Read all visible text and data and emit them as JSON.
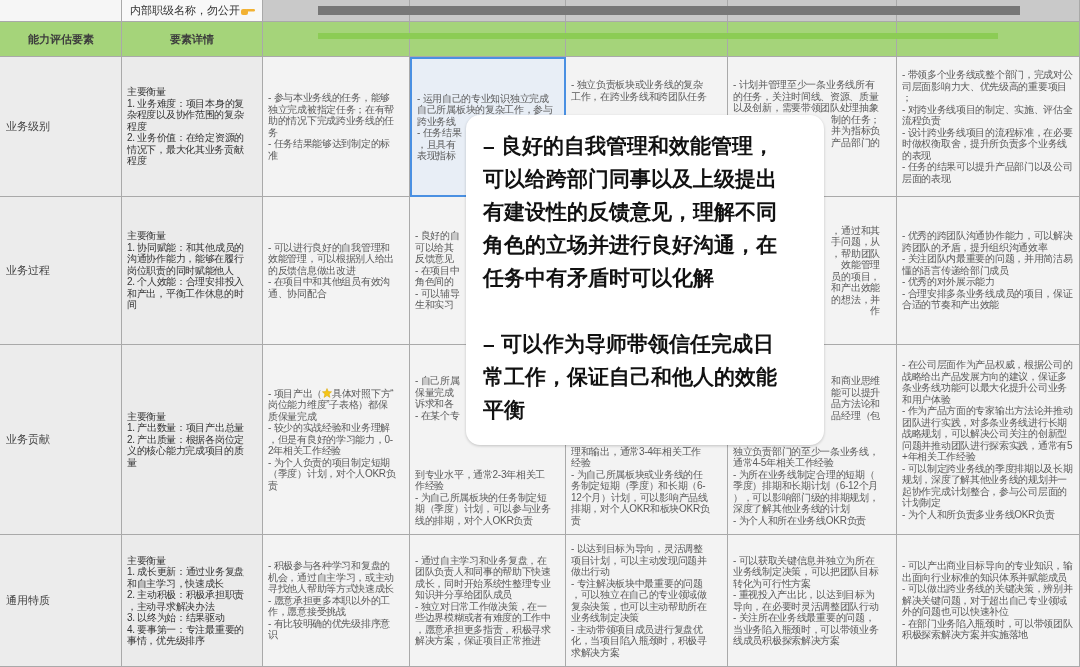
{
  "header": {
    "note": "内部职级名称，勿公开"
  },
  "columns": [
    "能力评估要素",
    "要素详情"
  ],
  "rows": [
    {
      "label": "业务级别",
      "detail": "主要衡量\n1. 业务难度：项目本身的复杂程度以及协作范围的复杂程度\n2. 业务价值：在给定资源的情况下，最大化其业务贡献程度",
      "cells": [
        {
          "kind": "text",
          "selected": false,
          "text": "- 参与本业务线的任务，能够独立完成被指定任务；在有帮助的情况下完成跨业务线的任务\n- 任务结果能够达到制定的标准"
        },
        {
          "kind": "pieces",
          "selected": true,
          "pieces": [
            {
              "text": "- 运用自己的专业知识独立完成自己所属板块的复杂工作，参与",
              "start_hidden": false
            },
            {
              "text": "跨业务线",
              "start_hidden": false
            },
            {
              "text": "- 任务结果",
              "start_hidden": false
            },
            {
              "text": "，且具有",
              "start_hidden": false
            },
            {
              "text": "表现指标",
              "start_hidden": false
            }
          ]
        },
        {
          "kind": "top",
          "selected": false,
          "pieces": [
            {
              "text": "- 独立负责板块或业务线的复杂工作，在跨业务线和跨团队任务",
              "start_hidden": false
            }
          ]
        },
        {
          "kind": "top",
          "selected": false,
          "pieces": [
            {
              "text": "- 计划并管理至少一条业务线所有的任务，关注时间线、资源、质量以及创新，需要带领团队处理抽象",
              "start_hidden": false
            },
            {
              "text": "制的任务；",
              "start_hidden": true
            },
            {
              "text": "并为指标负",
              "start_hidden": true
            },
            {
              "text": "产品部门的",
              "start_hidden": true
            }
          ]
        },
        {
          "kind": "text",
          "selected": false,
          "text": "- 带领多个业务线或整个部门，完成对公司层面影响力大、优先级高的重要项目；\n- 对跨业务线项目的制定、实施、评估全流程负责\n- 设计跨业务线项目的流程标准，在必要时做权衡取舍，提升所负责多个业务线的表现\n- 任务的结果可以提升产品部门以及公司层面的表现"
        }
      ]
    },
    {
      "label": "业务过程",
      "detail": "主要衡量\n1. 协同赋能：和其他成员的沟通协作能力，能够在履行岗位职责的同时赋能他人\n2. 个人效能：合理安排投入和产出，平衡工作休息的时间",
      "cells": [
        {
          "kind": "text",
          "selected": false,
          "text": "- 可以进行良好的自我管理和效能管理，可以根据别人给出的反馈信息做出改进\n- 在项目中和其他组员有效沟通、协同配合"
        },
        {
          "kind": "pieces",
          "selected": false,
          "pieces": [
            {
              "text": "- 良好的自",
              "start_hidden": false
            },
            {
              "text": "可以给其",
              "start_hidden": false
            },
            {
              "text": "反馈意见",
              "start_hidden": false
            },
            {
              "text": "- 在项目中",
              "start_hidden": false
            },
            {
              "text": "角色间的",
              "start_hidden": false
            },
            {
              "text": "- 可以辅导",
              "start_hidden": false
            },
            {
              "text": "生和实习",
              "start_hidden": false
            }
          ]
        },
        {
          "kind": "covered"
        },
        {
          "kind": "pieces",
          "selected": false,
          "pieces": [
            {
              "text": "，通过和其",
              "start_hidden": true
            },
            {
              "text": "手问题，从",
              "start_hidden": true
            },
            {
              "text": "，帮助团队",
              "start_hidden": true
            },
            {
              "text": "效能管理",
              "start_hidden": true
            },
            {
              "text": "员的项目，",
              "start_hidden": true
            },
            {
              "text": "和产出效能",
              "start_hidden": true
            },
            {
              "text": "的想法，并",
              "start_hidden": true
            },
            {
              "text": "作",
              "start_hidden": true
            }
          ]
        },
        {
          "kind": "text",
          "selected": false,
          "text": "- 优秀的跨团队沟通协作能力，可以解决跨团队的矛盾，提升组织沟通效率\n- 关注团队内最重要的问题，并用简洁易懂的语言传递给部门成员\n- 优秀的对外展示能力\n- 合理安排多条业务线成员的项目，保证合适的节奏和产出效能"
        }
      ]
    },
    {
      "label": "业务贡献",
      "detail": "主要衡量\n1. 产出数量：项目产出总量\n2. 产出质量：根据各岗位定义的核心能力完成项目的质量",
      "cells": [
        {
          "kind": "star_text",
          "selected": false,
          "before": "- 项目产出（",
          "text": "具体对照下方“岗位能力维度”子表格）都保质保量完成\n- 较少的实战经验和业务理解，但是有良好的学习能力，0-2年相关工作经验\n- 为个人负责的项目制定短期（季度）计划，对个人OKR负责"
        },
        {
          "kind": "split",
          "selected": false,
          "above": [
            {
              "text": "- 自己所属",
              "start_hidden": false
            },
            {
              "text": "保量完成",
              "start_hidden": false
            },
            {
              "text": "诉求和各",
              "start_hidden": false
            },
            {
              "text": "- 在某个专",
              "start_hidden": false
            }
          ],
          "below": [
            {
              "text": "到专业水平，通常2-3年相关工作经验\n- 为自己所属板块的任务制定短期（季度）计划，可以参与业务线的排期，对个人OKR负责",
              "start_hidden": false
            }
          ]
        },
        {
          "kind": "bottom",
          "selected": false,
          "pieces": [
            {
              "text": "理和输出，通常3-4年相关工作经验\n- 为自己所属板块或业务线的任务制定短期（季度）和长期（6-12个月）计划，可以影响产品线排期，对个人OKR和板块OKR负责",
              "start_hidden": false
            }
          ]
        },
        {
          "kind": "split",
          "selected": false,
          "above": [
            {
              "text": "和商业思维",
              "start_hidden": true
            },
            {
              "text": "能可以提升",
              "start_hidden": true
            },
            {
              "text": "品方法论和",
              "start_hidden": true
            },
            {
              "text": "品经理（包",
              "start_hidden": true
            }
          ],
          "below": [
            {
              "text": "独立负责部门的至少一条业务线，通常4-5年相关工作经验\n- 为所在业务线制定合理的短期（季度）排期和长期计划（6-12个月），可以影响部门级的排期规划，深度了解其他业务线的计划\n- 为个人和所在业务线OKR负责",
              "start_hidden": false
            }
          ]
        },
        {
          "kind": "text",
          "selected": false,
          "text": "- 在公司层面作为产品权威，根据公司的战略给出产品发展方向的建议，保证多条业务线功能可以最大化提升公司业务和用户体验\n- 作为产品方面的专家输出方法论并推动团队进行实践，对多条业务线进行长期战略规划，可以解决公司关注的创新型问题并推动团队进行探索实践，通常有5+年相关工作经验\n- 可以制定跨业务线的季度排期以及长期规划，深度了解其他业务线的规划并一起协作完成计划整合，参与公司层面的计划制定\n- 为个人和所负责多业务线OKR负责"
        }
      ]
    },
    {
      "label": "通用特质",
      "detail": "主要衡量\n1. 成长更新：通过业务复盘和自主学习，快速成长\n2. 主动积极：积极承担职责，主动寻求解决办法\n3. 以终为始：结果驱动\n4. 要事第一：专注最重要的事情，优先级排序",
      "cells": [
        {
          "kind": "text",
          "selected": false,
          "text": "- 积极参与各种学习和复盘的机会，通过自主学习，或主动寻找他人帮助等方式快速成长\n- 愿意承担更多本职以外的工作，愿意接受挑战\n- 有比较明确的优先级排序意识"
        },
        {
          "kind": "text",
          "selected": false,
          "text": "- 通过自主学习和业务复盘，在团队负责人和同事的帮助下快速成长，同时开始系统性整理专业知识并分享给团队成员\n- 独立对日常工作做决策，在一些边界模糊或者有难度的工作中，愿意承担更多指责，积极寻求解决方案，保证项目正常推进"
        },
        {
          "kind": "text",
          "selected": false,
          "text": "- 以达到目标为导向，灵活调整项目计划，可以主动发现问题并做出行动\n- 专注解决板块中最重要的问题，可以独立在自己的专业领域做复杂决策，也可以主动帮助所在业务线制定决策\n- 主动带领项目成员进行复盘优化，当项目陷入瓶颈时，积极寻求解决方案"
        },
        {
          "kind": "text",
          "selected": false,
          "text": "- 可以获取关键信息并独立为所在业务线制定决策，可以把团队目标转化为可行性方案\n- 重视投入产出比，以达到目标为导向，在必要时灵活调整团队行动\n- 关注所在业务线最重要的问题，当业务陷入瓶颈时，可以带领业务线成员积极探索解决方案"
        },
        {
          "kind": "text",
          "selected": false,
          "text": "- 可以产出商业目标导向的专业知识，输出面向行业标准的知识体系并赋能成员\n- 可以做出跨业务线的关键决策，辨别并解决关键问题，对于超出自己专业领域外的问题也可以快速补位\n- 在部门业务陷入瓶颈时，可以带领团队积极探索解决方案并实施落地"
        }
      ]
    }
  ],
  "popup": {
    "paragraphs": [
      "– 良好的自我管理和效能管理，可以给跨部门同事以及上级提出有建设性的反馈意见，理解不同角色的立场并进行良好沟通，在任务中有矛盾时可以化解",
      "– 可以作为导师带领信任完成日常工作，保证自己和他人的效能平衡"
    ]
  }
}
